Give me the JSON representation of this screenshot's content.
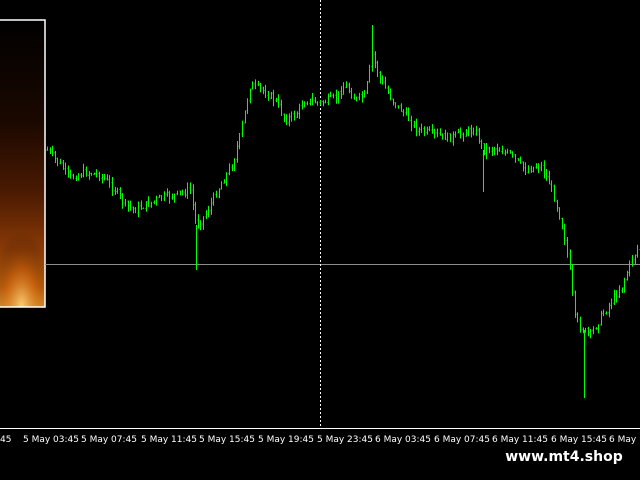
{
  "chart": {
    "colors": {
      "background": "#000000",
      "candles": "#00ff00",
      "axis": "#ffffff",
      "price_line": "#8c8c8c",
      "crosshair": "#ffffff",
      "panel_border": "#ffffff"
    },
    "time_labels": [
      "5 May 03:45",
      "5 May 07:45",
      "5 May 11:45",
      "5 May 15:45",
      "5 May 19:45",
      "5 May 23:45",
      "6 May 03:45",
      "6 May 07:45",
      "6 May 11:45",
      "6 May 15:45",
      "6 May 1"
    ],
    "left_label_fragment": "45"
  },
  "watermark": {
    "text": "www.mt4.shop"
  }
}
